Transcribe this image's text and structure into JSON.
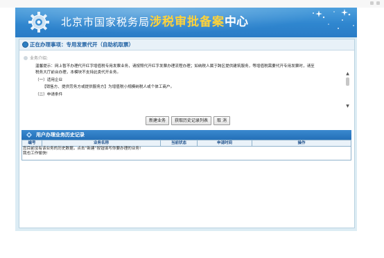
{
  "banner": {
    "title_part1": "北京市国家税务局",
    "title_part2": "涉税审批备案",
    "title_part3": "中心"
  },
  "current_item": {
    "label": "正在办理事项：专用发票代开（自助机取票）"
  },
  "intro": {
    "heading": "业务介绍:",
    "lines": [
      "温馨提示：网上暂不办理代开红字增值税专用发票业务，请按照代开红字发票办理流程办理；如纳税人属于跨区提供建筑服务，等增值税需要代开专用发票时，请至",
      "税务大厅前台办理，本模块不支持此类代开业务。",
      "（一）适用企业",
      "【销售方、提供劳务方或提供服务方】为增值税小规模纳税人或个体工商户。",
      "（二）申请条件"
    ]
  },
  "buttons": {
    "new": "新建业务",
    "history_list": "获取历史记录列表",
    "cancel": "取 消"
  },
  "history": {
    "title": "用户办理业务历史记录",
    "columns": [
      "编号",
      "业务名称",
      "当前状态",
      "申请时间",
      "操作"
    ],
    "empty_line1": "您目前没有该业务的历史数据，点击“新建”按钮填写你要办理的业务!",
    "empty_line2": "我也工作愉快!"
  },
  "colors": {
    "banner_blue": "#2f86cf",
    "title_yellow": "#ffd23a",
    "frame_bg": "#dcecf4",
    "header_text_blue": "#1d5fa2"
  },
  "icons": {
    "logo": "gear-icon",
    "current_item": "circle-bullet-icon",
    "history": "diamond-icon",
    "scroll_up": "arrow-up-icon",
    "scroll_down": "arrow-down-icon"
  }
}
